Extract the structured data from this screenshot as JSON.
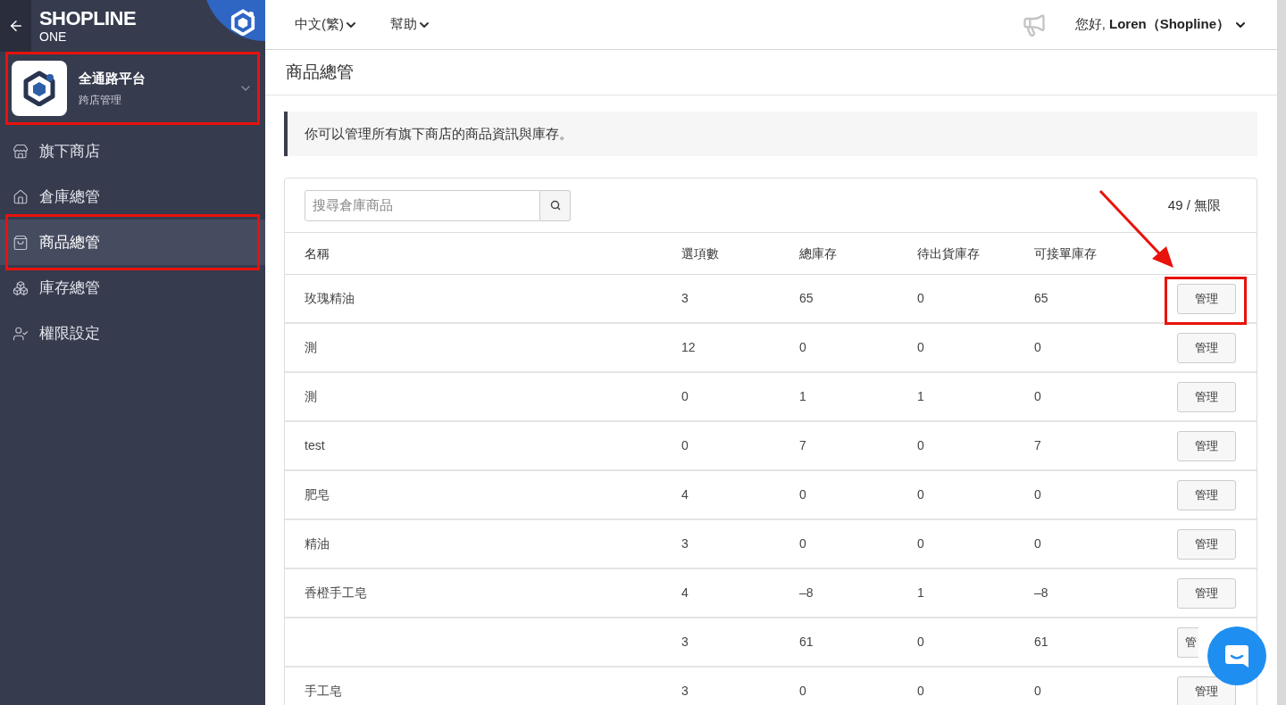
{
  "brand": {
    "name": "SHOPLINE",
    "sub": "ONE"
  },
  "store_switcher": {
    "title": "全通路平台",
    "subtitle": "跨店管理",
    "highlighted": true
  },
  "sidebar": {
    "items": [
      {
        "label": "旗下商店",
        "selected": false,
        "highlighted": false
      },
      {
        "label": "倉庫總管",
        "selected": false,
        "highlighted": false
      },
      {
        "label": "商品總管",
        "selected": true,
        "highlighted": true
      },
      {
        "label": "庫存總管",
        "selected": false,
        "highlighted": false
      },
      {
        "label": "權限設定",
        "selected": false,
        "highlighted": false
      }
    ]
  },
  "topbar": {
    "menus": [
      "中文(繁)",
      "幫助"
    ],
    "greeting": "您好,",
    "user": "Loren（Shopline）"
  },
  "page_title": "商品總管",
  "notice": "你可以管理所有旗下商店的商品資訊與庫存。",
  "search": {
    "placeholder": "搜尋倉庫商品"
  },
  "quota": "49 / 無限",
  "table": {
    "columns": [
      "名稱",
      "選項數",
      "總庫存",
      "待出貨庫存",
      "可接單庫存"
    ],
    "rows": [
      {
        "cells": [
          "玫瑰精油",
          "3",
          "65",
          "0",
          "65"
        ],
        "action": "管理",
        "highlighted": true,
        "covered": false
      },
      {
        "cells": [
          "測",
          "12",
          "0",
          "0",
          "0"
        ],
        "action": "管理",
        "highlighted": false,
        "covered": false
      },
      {
        "cells": [
          "測",
          "0",
          "1",
          "1",
          "0"
        ],
        "action": "管理",
        "highlighted": false,
        "covered": false
      },
      {
        "cells": [
          "test",
          "0",
          "7",
          "0",
          "7"
        ],
        "action": "管理",
        "highlighted": false,
        "covered": false
      },
      {
        "cells": [
          "肥皂",
          "4",
          "0",
          "0",
          "0"
        ],
        "action": "管理",
        "highlighted": false,
        "covered": false
      },
      {
        "cells": [
          "精油",
          "3",
          "0",
          "0",
          "0"
        ],
        "action": "管理",
        "highlighted": false,
        "covered": false
      },
      {
        "cells": [
          "香橙手工皂",
          "4",
          "–8",
          "1",
          "–8"
        ],
        "action": "管理",
        "highlighted": false,
        "covered": false
      },
      {
        "cells": [
          "",
          "3",
          "61",
          "0",
          "61"
        ],
        "action": "管",
        "highlighted": false,
        "covered": true
      },
      {
        "cells": [
          "手工皂",
          "3",
          "0",
          "0",
          "0"
        ],
        "action": "管理",
        "highlighted": false,
        "covered": false
      }
    ]
  }
}
